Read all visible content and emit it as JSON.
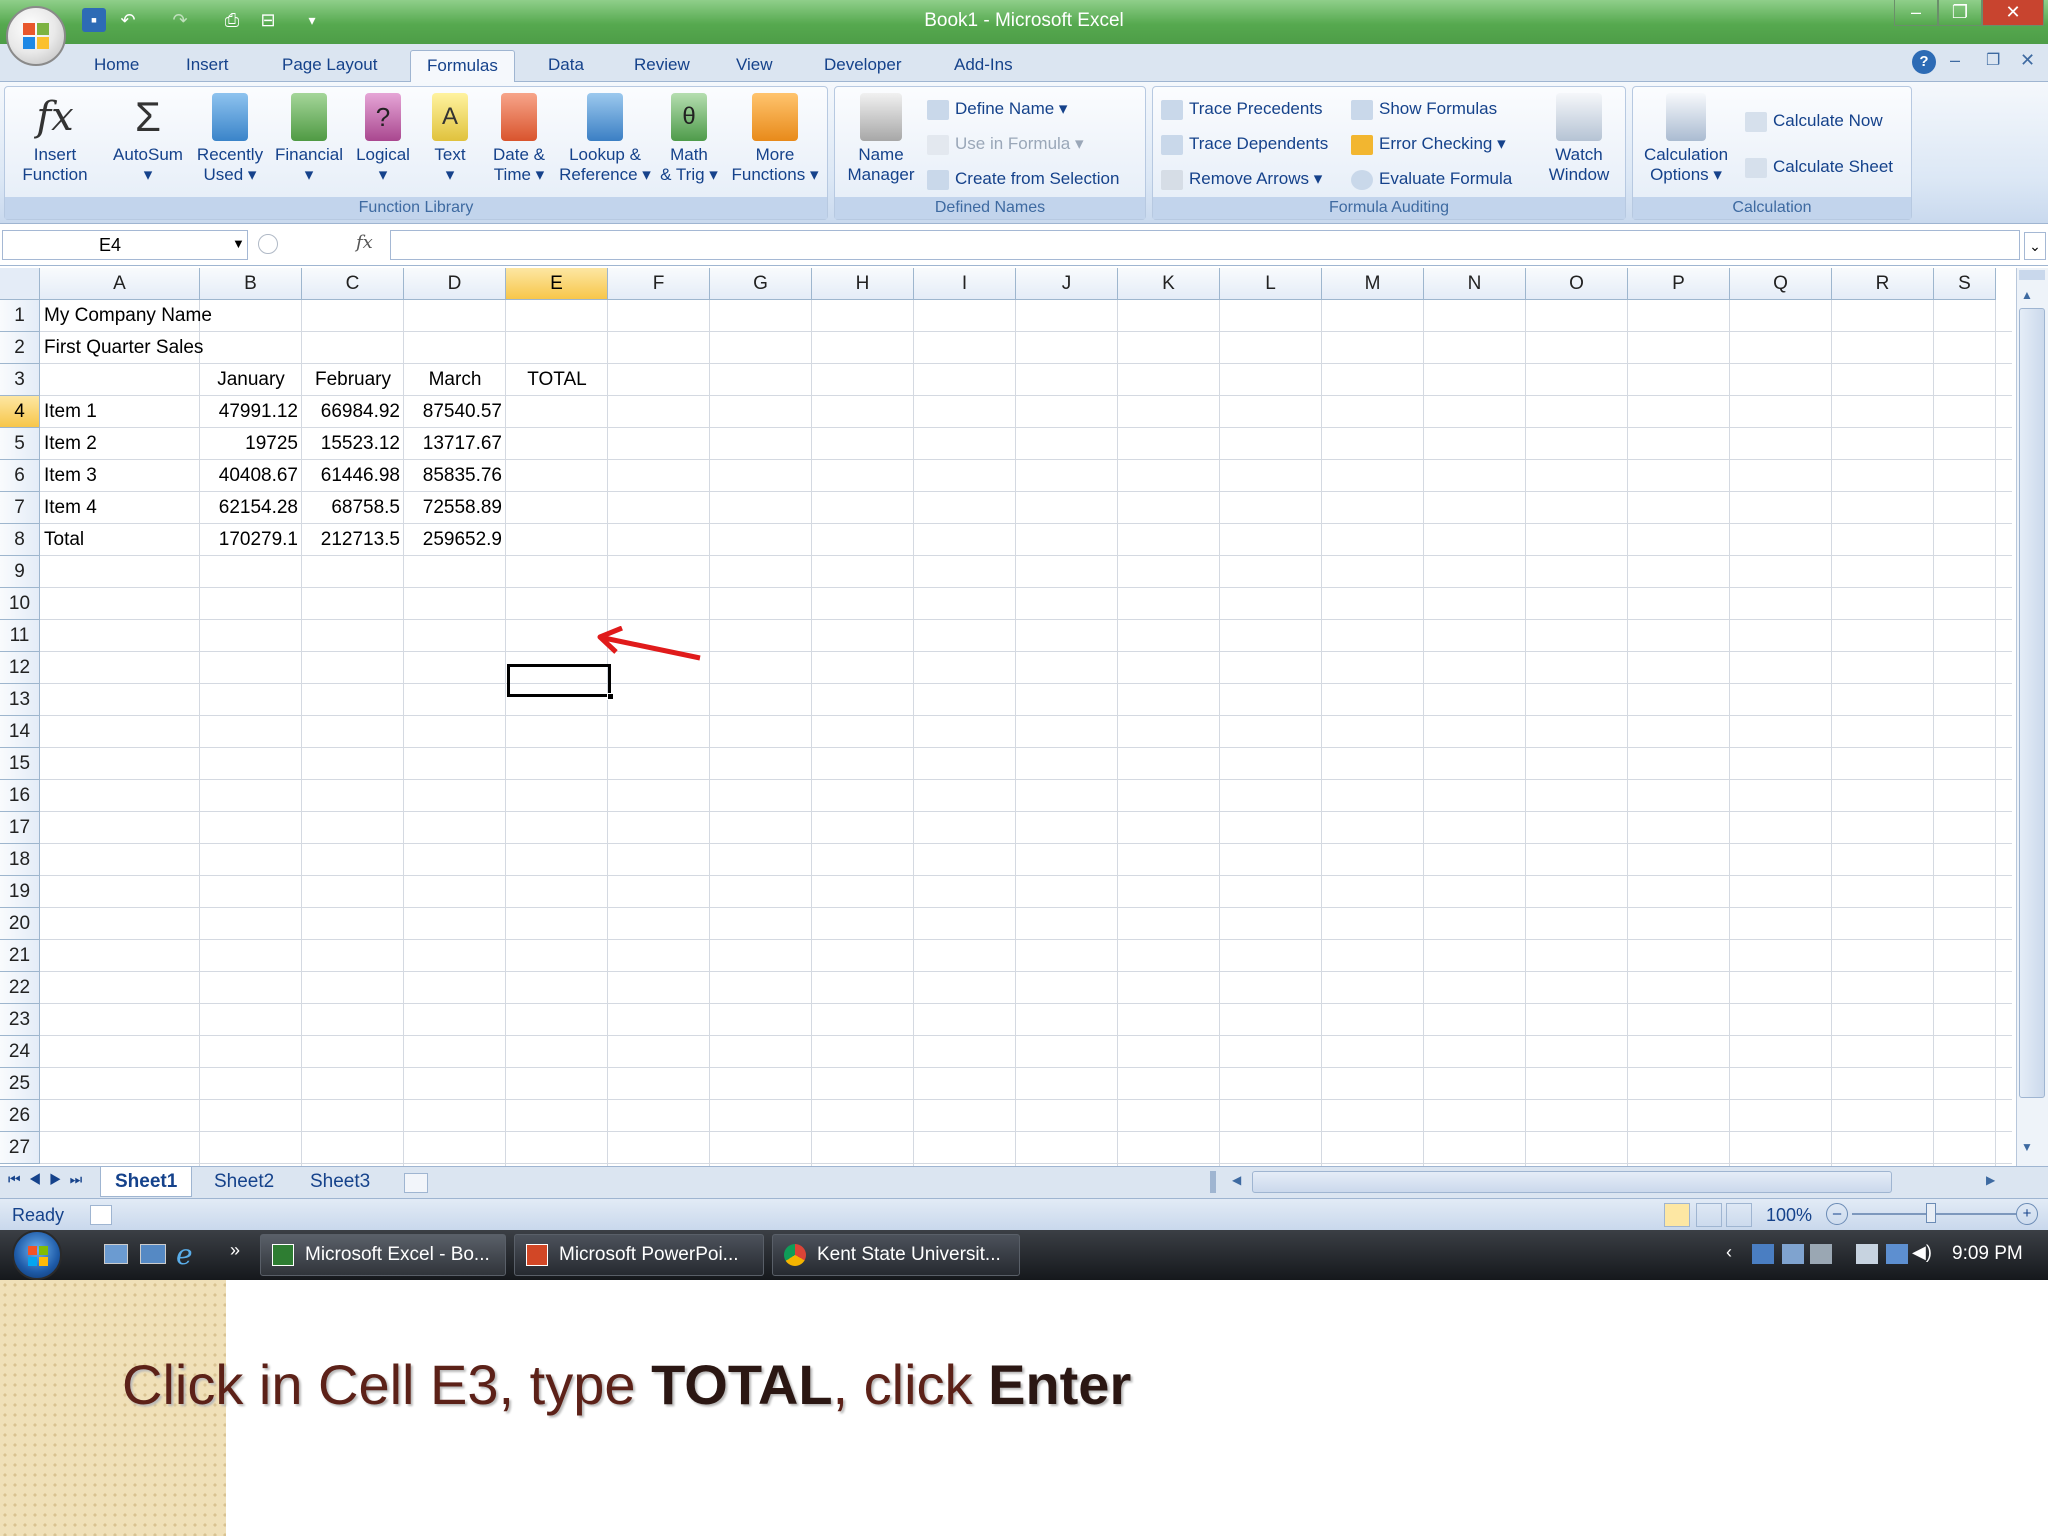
{
  "window": {
    "title": "Book1 - Microsoft Excel"
  },
  "quick_access": [
    "save-icon",
    "undo-icon",
    "redo-icon",
    "print-preview-icon",
    "print-icon",
    "customize-icon"
  ],
  "tabs": [
    {
      "label": "Home"
    },
    {
      "label": "Insert"
    },
    {
      "label": "Page Layout"
    },
    {
      "label": "Formulas",
      "active": true
    },
    {
      "label": "Data"
    },
    {
      "label": "Review"
    },
    {
      "label": "View"
    },
    {
      "label": "Developer"
    },
    {
      "label": "Add-Ins"
    }
  ],
  "ribbon": {
    "function_library": {
      "label": "Function Library",
      "buttons": [
        {
          "l1": "Insert",
          "l2": "Function"
        },
        {
          "l1": "AutoSum",
          "l2": "▾"
        },
        {
          "l1": "Recently",
          "l2": "Used ▾"
        },
        {
          "l1": "Financial",
          "l2": "▾"
        },
        {
          "l1": "Logical",
          "l2": "▾"
        },
        {
          "l1": "Text",
          "l2": "▾"
        },
        {
          "l1": "Date &",
          "l2": "Time ▾"
        },
        {
          "l1": "Lookup &",
          "l2": "Reference ▾"
        },
        {
          "l1": "Math",
          "l2": "& Trig ▾"
        },
        {
          "l1": "More",
          "l2": "Functions ▾"
        }
      ]
    },
    "defined_names": {
      "label": "Defined Names",
      "name_manager": {
        "l1": "Name",
        "l2": "Manager"
      },
      "define_name": "Define Name ▾",
      "use_in_formula": "Use in Formula ▾",
      "create_from_selection": "Create from Selection"
    },
    "formula_auditing": {
      "label": "Formula Auditing",
      "trace_precedents": "Trace Precedents",
      "trace_dependents": "Trace Dependents",
      "remove_arrows": "Remove Arrows ▾",
      "show_formulas": "Show Formulas",
      "error_checking": "Error Checking ▾",
      "evaluate_formula": "Evaluate Formula",
      "watch_window": {
        "l1": "Watch",
        "l2": "Window"
      }
    },
    "calculation": {
      "label": "Calculation",
      "options": {
        "l1": "Calculation",
        "l2": "Options ▾"
      },
      "calculate_now": "Calculate Now",
      "calculate_sheet": "Calculate Sheet"
    }
  },
  "formula_bar": {
    "name_box": "E4",
    "fx": "fx",
    "formula": ""
  },
  "sheet": {
    "columns": [
      "A",
      "B",
      "C",
      "D",
      "E",
      "F",
      "G",
      "H",
      "I",
      "J",
      "K",
      "L",
      "M",
      "N",
      "O",
      "P",
      "Q",
      "R",
      "S"
    ],
    "selected_column": "E",
    "selected_row": "4",
    "rows": [
      "1",
      "2",
      "3",
      "4",
      "5",
      "6",
      "7",
      "8",
      "9",
      "10",
      "11",
      "12",
      "13",
      "14",
      "15",
      "16",
      "17",
      "18",
      "19",
      "20",
      "21",
      "22",
      "23",
      "24",
      "25",
      "26",
      "27"
    ],
    "cells": {
      "A1": "My Company Name",
      "A2": "First Quarter Sales",
      "B3": "January",
      "C3": "February",
      "D3": "March",
      "E3": "TOTAL",
      "A4": "Item 1",
      "B4": "47991.12",
      "C4": "66984.92",
      "D4": "87540.57",
      "A5": "Item 2",
      "B5": "19725",
      "C5": "15523.12",
      "D5": "13717.67",
      "A6": "Item 3",
      "B6": "40408.67",
      "C6": "61446.98",
      "D6": "85835.76",
      "A7": "Item 4",
      "B7": "62154.28",
      "C7": "68758.5",
      "D7": "72558.89",
      "A8": "Total",
      "B8": "170279.1",
      "C8": "212713.5",
      "D8": "259652.9"
    }
  },
  "sheet_tabs": [
    {
      "label": "Sheet1",
      "active": true
    },
    {
      "label": "Sheet2"
    },
    {
      "label": "Sheet3"
    }
  ],
  "status": {
    "mode": "Ready",
    "zoom": "100%"
  },
  "taskbar": {
    "items": [
      "Microsoft Excel - Bo...",
      "Microsoft PowerPoi...",
      "Kent State Universit..."
    ],
    "clock": "9:09 PM",
    "chevron": "»"
  },
  "instruction": {
    "p1": "Click in Cell E3, type ",
    "b1": "TOTAL",
    "p2": ", click ",
    "b2": "Enter"
  },
  "colors": {
    "title_green": "#56a94f",
    "ribbon_text": "#15428b",
    "arrow_red": "#e01b1b",
    "instruction_text": "#5c2118"
  }
}
